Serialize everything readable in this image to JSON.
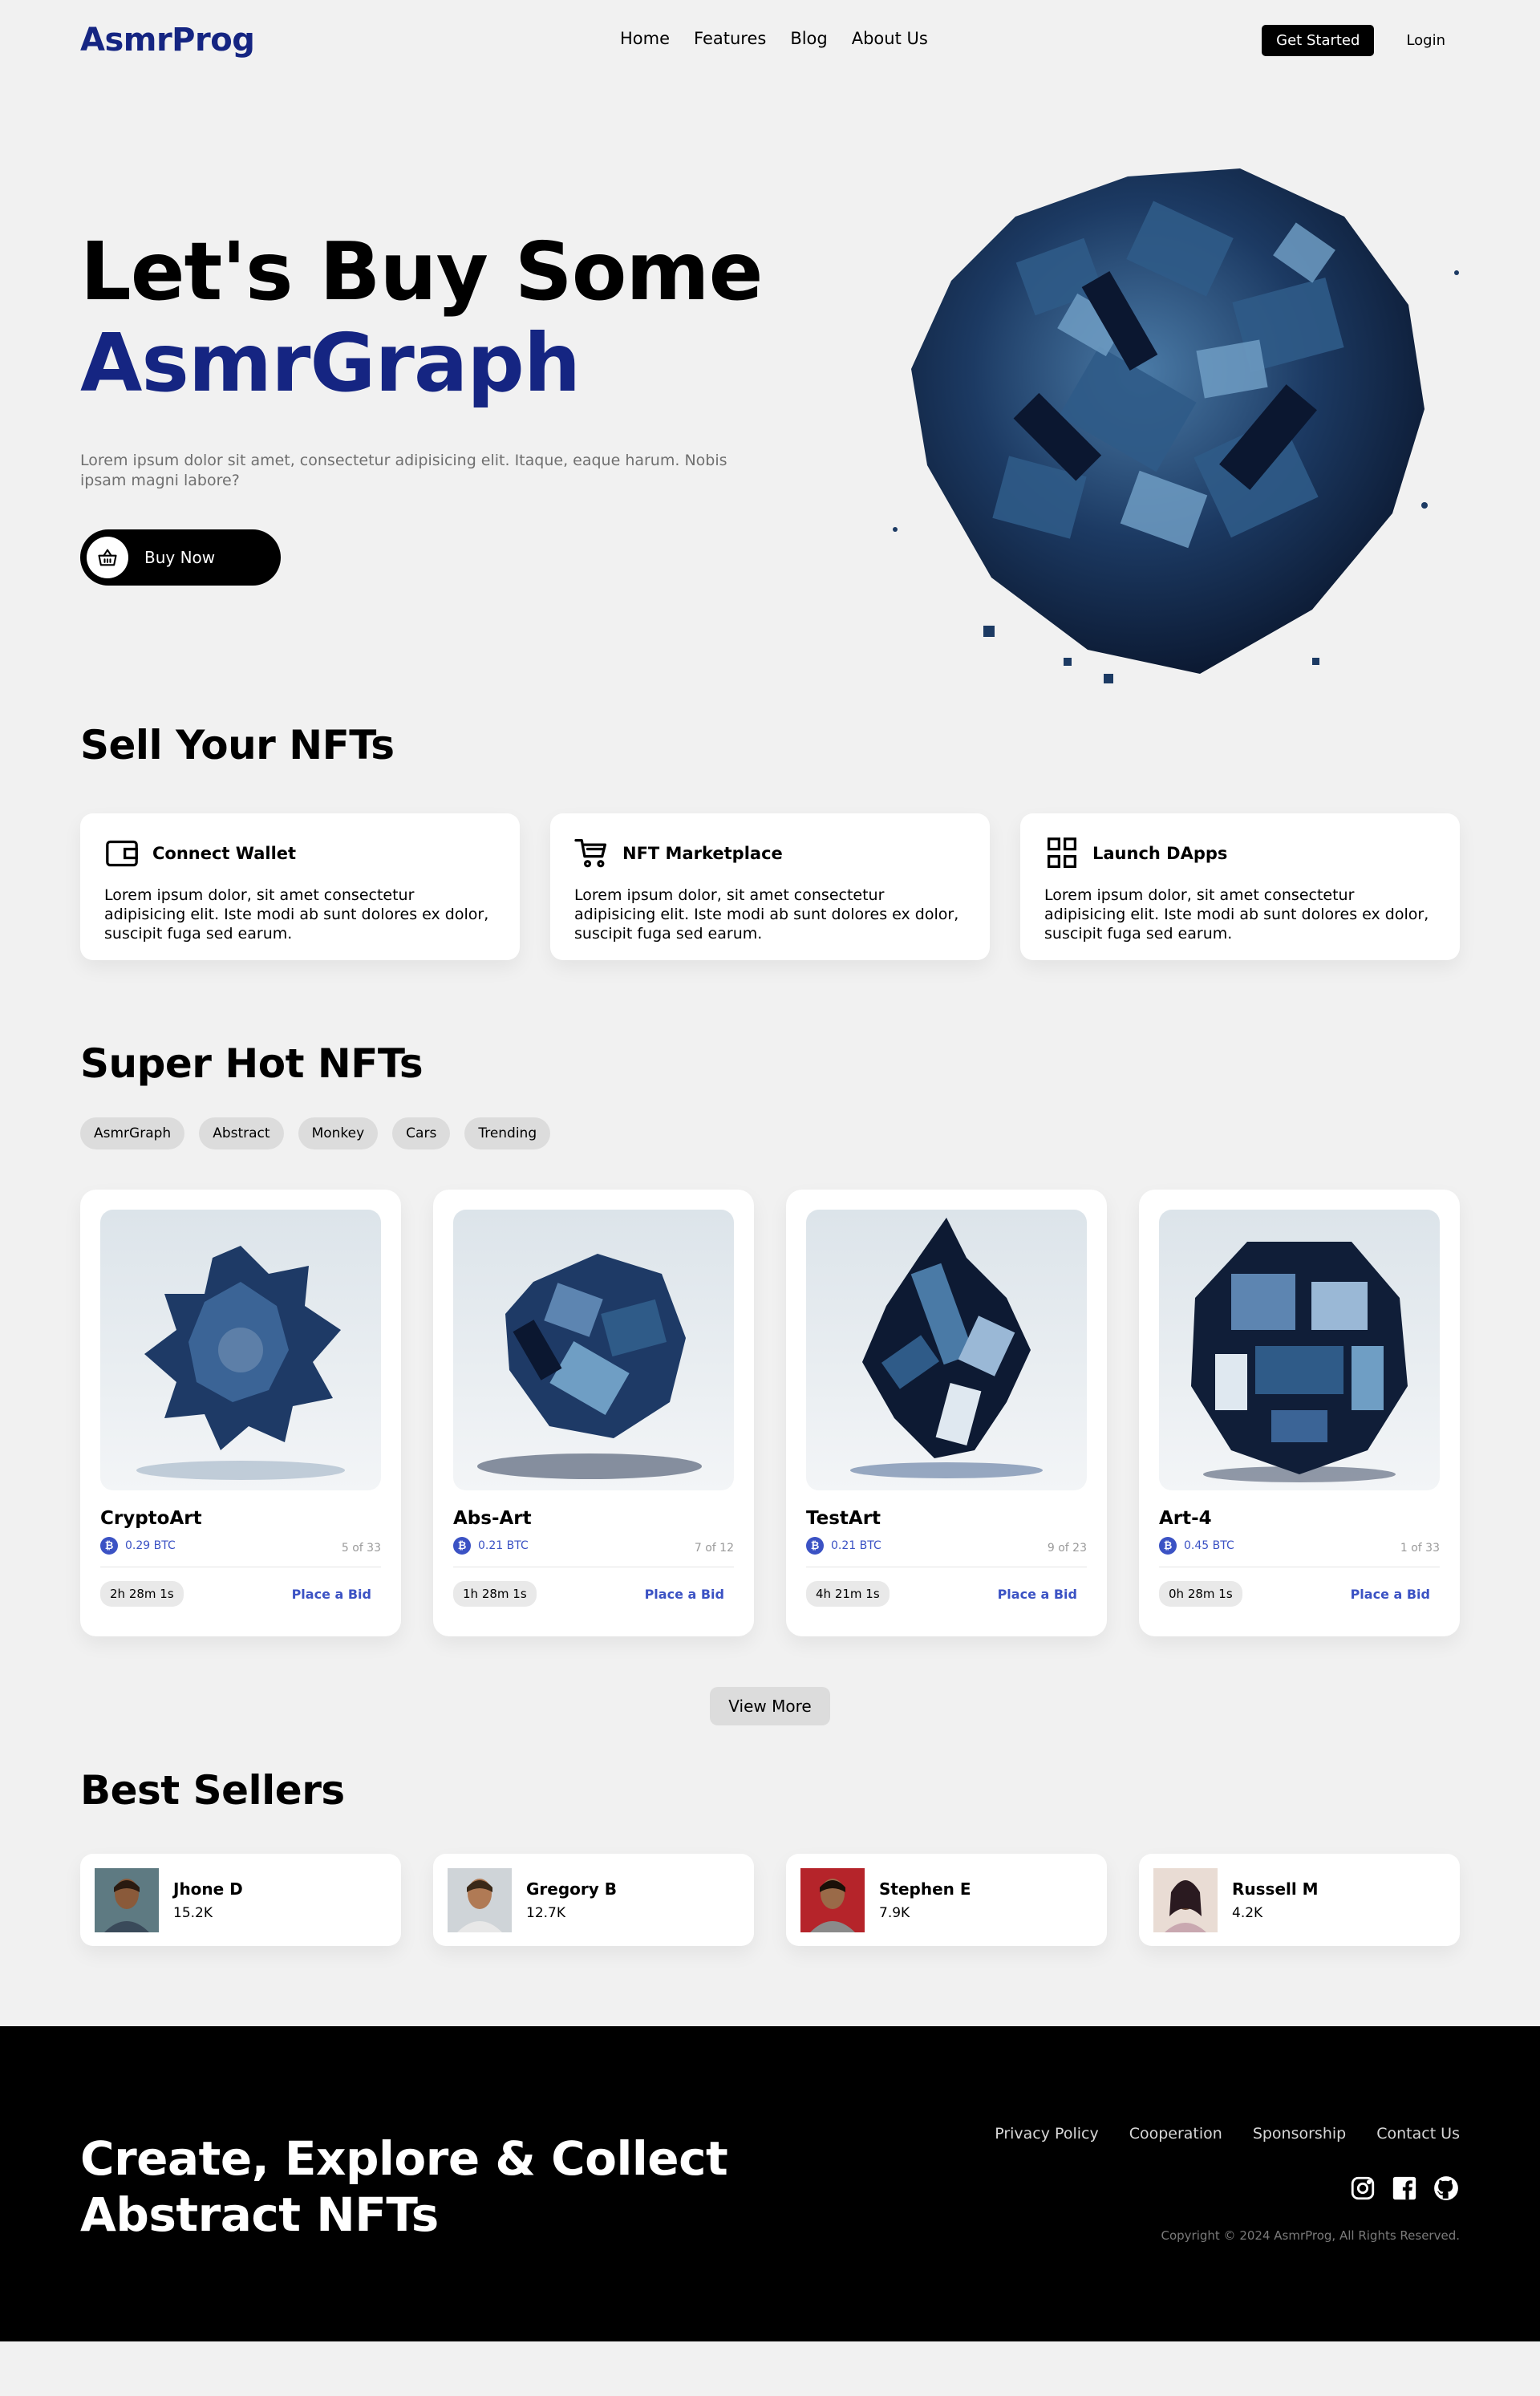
{
  "brand": {
    "name": "AsmrProg",
    "accent": "#152582",
    "link_blue": "#3b52c4"
  },
  "nav": {
    "links": [
      "Home",
      "Features",
      "Blog",
      "About Us"
    ],
    "cta": "Get Started",
    "login": "Login"
  },
  "hero": {
    "title_line1": "Let's Buy Some",
    "title_line2": "AsmrGraph",
    "description": "Lorem ipsum dolor sit amet, consectetur adipisicing elit. Itaque, eaque harum. Nobis ipsam magni labore?",
    "button": "Buy Now",
    "button_icon": "basket-icon"
  },
  "sell": {
    "title": "Sell Your NFTs",
    "features": [
      {
        "icon": "wallet-icon",
        "title": "Connect Wallet",
        "text": "Lorem ipsum dolor, sit amet consectetur adipisicing elit. Iste modi ab sunt dolores ex dolor, suscipit fuga sed earum."
      },
      {
        "icon": "cart-icon",
        "title": "NFT Marketplace",
        "text": "Lorem ipsum dolor, sit amet consectetur adipisicing elit. Iste modi ab sunt dolores ex dolor, suscipit fuga sed earum."
      },
      {
        "icon": "grid-icon",
        "title": "Launch DApps",
        "text": "Lorem ipsum dolor, sit amet consectetur adipisicing elit. Iste modi ab sunt dolores ex dolor, suscipit fuga sed earum."
      }
    ]
  },
  "hot": {
    "title": "Super Hot NFTs",
    "tags": [
      "AsmrGraph",
      "Abstract",
      "Monkey",
      "Cars",
      "Trending"
    ],
    "items": [
      {
        "name": "CryptoArt",
        "price": "0.29 BTC",
        "edition": "5 of 33",
        "time": "2h 28m 1s",
        "bid": "Place a Bid"
      },
      {
        "name": "Abs-Art",
        "price": "0.21 BTC",
        "edition": "7 of 12",
        "time": "1h 28m 1s",
        "bid": "Place a Bid"
      },
      {
        "name": "TestArt",
        "price": "0.21 BTC",
        "edition": "9 of 23",
        "time": "4h 21m 1s",
        "bid": "Place a Bid"
      },
      {
        "name": "Art-4",
        "price": "0.45 BTC",
        "edition": "1 of 33",
        "time": "0h 28m 1s",
        "bid": "Place a Bid"
      }
    ],
    "view_more": "View More"
  },
  "best": {
    "title": "Best Sellers",
    "sellers": [
      {
        "name": "Jhone D",
        "count": "15.2K"
      },
      {
        "name": "Gregory B",
        "count": "12.7K"
      },
      {
        "name": "Stephen E",
        "count": "7.9K"
      },
      {
        "name": "Russell M",
        "count": "4.2K"
      }
    ]
  },
  "footer": {
    "title_line1": "Create, Explore & Collect",
    "title_line2": "Abstract NFTs",
    "links": [
      "Privacy Policy",
      "Cooperation",
      "Sponsorship",
      "Contact Us"
    ],
    "social": [
      "instagram-icon",
      "facebook-icon",
      "github-icon"
    ],
    "copyright": "Copyright © 2024 AsmrProg, All Rights Reserved."
  }
}
